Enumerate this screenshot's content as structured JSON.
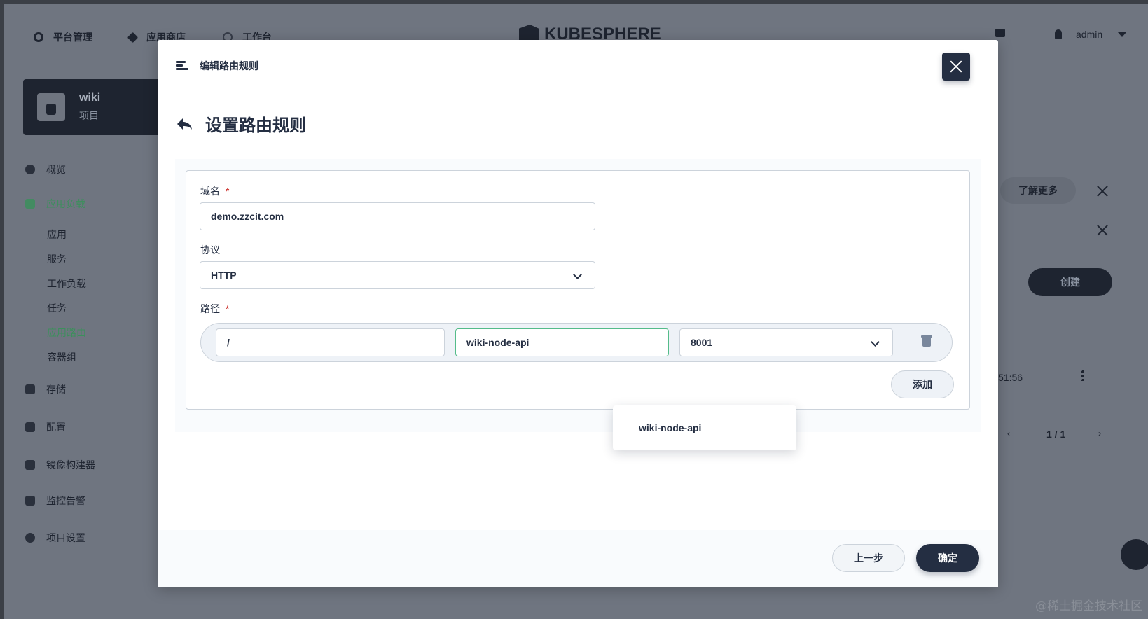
{
  "topnav": {
    "items": [
      {
        "label": "平台管理",
        "icon": "gear-icon"
      },
      {
        "label": "应用商店",
        "icon": "app-store-icon"
      },
      {
        "label": "工作台",
        "icon": "workbench-icon"
      }
    ],
    "logo_text": "KUBESPHERE",
    "user": "admin"
  },
  "sidebar": {
    "project_name": "wiki",
    "project_type": "项目",
    "items": [
      {
        "label": "概览",
        "icon": "overview-icon"
      },
      {
        "label": "应用负载",
        "icon": "workload-icon",
        "active": true
      },
      {
        "label": "存储",
        "icon": "storage-icon"
      },
      {
        "label": "配置",
        "icon": "config-icon"
      },
      {
        "label": "镜像构建器",
        "icon": "image-builder-icon"
      },
      {
        "label": "监控告警",
        "icon": "monitoring-icon"
      },
      {
        "label": "项目设置",
        "icon": "settings-icon"
      }
    ],
    "sub_items": [
      {
        "label": "应用"
      },
      {
        "label": "服务"
      },
      {
        "label": "工作负载"
      },
      {
        "label": "任务"
      },
      {
        "label": "应用路由",
        "active": true
      },
      {
        "label": "容器组"
      }
    ]
  },
  "background": {
    "learn_more": "了解更多",
    "create": "创建",
    "time_fragment": "51:56",
    "pagination": "1 / 1"
  },
  "modal": {
    "title": "编辑路由规则",
    "step_title": "设置路由规则",
    "domain_label": "域名",
    "domain_value": "demo.zzcit.com",
    "protocol_label": "协议",
    "protocol_value": "HTTP",
    "path_label": "路径",
    "path_value": "/",
    "service_value": "wiki-node-api",
    "port_value": "8001",
    "add_label": "添加",
    "suggestion": "wiki-node-api",
    "prev_label": "上一步",
    "ok_label": "确定"
  },
  "watermark": "@稀土掘金技术社区",
  "colors": {
    "primary": "#242e42",
    "success": "#55bc8a",
    "required": "#ca2621",
    "overlay": "#6f7580"
  }
}
